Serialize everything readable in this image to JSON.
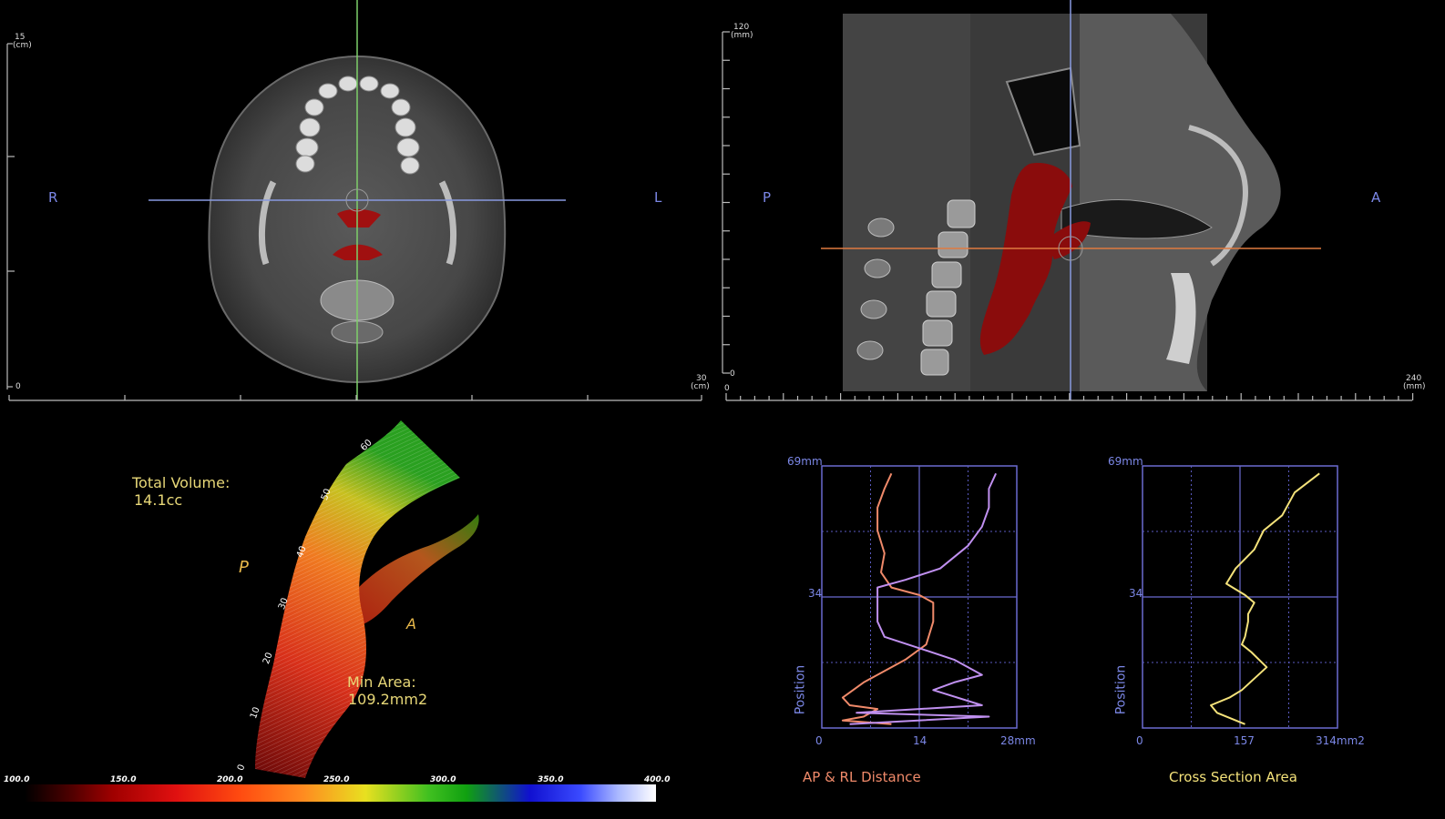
{
  "axial_view": {
    "scale_top": "15",
    "scale_top_unit": "(cm)",
    "scale_origin": "0",
    "scale_right": "30",
    "scale_right_unit": "(cm)",
    "left_label": "R",
    "right_label": "L"
  },
  "sagittal_view": {
    "scale_top": "120",
    "scale_top_unit": "(mm)",
    "scale_origin_y": "0",
    "scale_origin_x": "0",
    "scale_right": "240",
    "scale_right_unit": "(mm)",
    "left_label": "P",
    "right_label": "A"
  },
  "airway_3d": {
    "total_volume_label": "Total Volume:",
    "total_volume_value": "14.1cc",
    "min_area_label": "Min Area:",
    "min_area_value": "109.2mm2",
    "posterior_label": "P",
    "anterior_label": "A",
    "height_ticks": [
      "0",
      "10",
      "20",
      "30",
      "40",
      "50",
      "60"
    ]
  },
  "colorbar": {
    "labels": [
      "100.0",
      "150.0",
      "200.0",
      "250.0",
      "300.0",
      "350.0",
      "400.0"
    ]
  },
  "chart_data": [
    {
      "type": "line",
      "title": "AP & RL Distance",
      "ylabel": "Position",
      "x_ticks": [
        "0",
        "14",
        "28mm"
      ],
      "y_ticks": [
        "69mm",
        "34"
      ],
      "xlim": [
        0,
        28
      ],
      "ylim": [
        0,
        69
      ],
      "series": [
        {
          "color": "#f08a6a",
          "points": [
            [
              10,
              67
            ],
            [
              9,
              63
            ],
            [
              8,
              58
            ],
            [
              8,
              52
            ],
            [
              9,
              46
            ],
            [
              8.5,
              41
            ],
            [
              10,
              37
            ],
            [
              14,
              35
            ],
            [
              16,
              33
            ],
            [
              16,
              28
            ],
            [
              15,
              22
            ],
            [
              12,
              18
            ],
            [
              9,
              15
            ],
            [
              6,
              12
            ],
            [
              3,
              8
            ],
            [
              4,
              6
            ],
            [
              8,
              5
            ],
            [
              6,
              3
            ],
            [
              3,
              2
            ],
            [
              10,
              1
            ]
          ]
        },
        {
          "color": "#c090f0",
          "points": [
            [
              25,
              67
            ],
            [
              24,
              63
            ],
            [
              24,
              58
            ],
            [
              23,
              53
            ],
            [
              21,
              48
            ],
            [
              17,
              42
            ],
            [
              12,
              39
            ],
            [
              8,
              37
            ],
            [
              8,
              33
            ],
            [
              8,
              28
            ],
            [
              9,
              24
            ],
            [
              14,
              21
            ],
            [
              19,
              18
            ],
            [
              23,
              14
            ],
            [
              19,
              12
            ],
            [
              16,
              10
            ],
            [
              23,
              6
            ],
            [
              5,
              4
            ],
            [
              24,
              3
            ],
            [
              4,
              1
            ]
          ]
        }
      ]
    },
    {
      "type": "line",
      "title": "Cross Section Area",
      "ylabel": "Position",
      "x_ticks": [
        "0",
        "157",
        "314mm2"
      ],
      "y_ticks": [
        "69mm",
        "34"
      ],
      "xlim": [
        0,
        314
      ],
      "ylim": [
        0,
        69
      ],
      "series": [
        {
          "color": "#f4e27a",
          "points": [
            [
              285,
              67
            ],
            [
              245,
              62
            ],
            [
              225,
              56
            ],
            [
              195,
              52
            ],
            [
              180,
              47
            ],
            [
              150,
              42
            ],
            [
              135,
              38
            ],
            [
              165,
              35
            ],
            [
              180,
              33
            ],
            [
              170,
              30
            ],
            [
              170,
              28
            ],
            [
              165,
              24
            ],
            [
              160,
              22
            ],
            [
              175,
              20
            ],
            [
              200,
              16
            ],
            [
              180,
              13
            ],
            [
              160,
              10
            ],
            [
              140,
              8
            ],
            [
              110,
              6
            ],
            [
              120,
              4
            ],
            [
              165,
              1
            ]
          ]
        }
      ]
    }
  ]
}
